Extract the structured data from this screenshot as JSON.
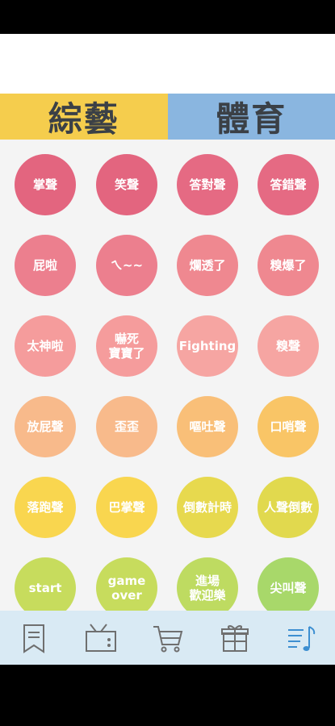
{
  "tabs": {
    "variety_label": "綜藝",
    "sports_label": "體育"
  },
  "sounds": [
    {
      "label": "掌聲",
      "color": "#e3657f"
    },
    {
      "label": "笑聲",
      "color": "#e3657f"
    },
    {
      "label": "答對聲",
      "color": "#e56a83"
    },
    {
      "label": "答錯聲",
      "color": "#e56a83"
    },
    {
      "label": "屁啦",
      "color": "#ec7f8e"
    },
    {
      "label": "ㄟ~~",
      "color": "#ec7f8e"
    },
    {
      "label": "爛透了",
      "color": "#ef8890"
    },
    {
      "label": "糗爆了",
      "color": "#ef8890"
    },
    {
      "label": "太神啦",
      "color": "#f59c9c"
    },
    {
      "label": "嚇死\n寶寶了",
      "color": "#f59c9c"
    },
    {
      "label": "Fighting",
      "color": "#f6a5a2"
    },
    {
      "label": "糗聲",
      "color": "#f6a5a2"
    },
    {
      "label": "放屁聲",
      "color": "#f8ba8b"
    },
    {
      "label": "歪歪",
      "color": "#f8ba8b"
    },
    {
      "label": "嘔吐聲",
      "color": "#f9bf78"
    },
    {
      "label": "口哨聲",
      "color": "#f9c566"
    },
    {
      "label": "落跑聲",
      "color": "#f9d64f"
    },
    {
      "label": "巴掌聲",
      "color": "#f9d64f"
    },
    {
      "label": "倒數計時",
      "color": "#e7d94e"
    },
    {
      "label": "人聲倒數",
      "color": "#e1d94e"
    },
    {
      "label": "start",
      "color": "#c7dc5d"
    },
    {
      "label": "game\nover",
      "color": "#c7dc5d"
    },
    {
      "label": "進場\n歡迎樂",
      "color": "#bedb61"
    },
    {
      "label": "尖叫聲",
      "color": "#a8d86a"
    }
  ],
  "nav": [
    {
      "icon": "bookmark-icon",
      "active": false
    },
    {
      "icon": "tv-icon",
      "active": false
    },
    {
      "icon": "cart-icon",
      "active": false
    },
    {
      "icon": "gift-icon",
      "active": false
    },
    {
      "icon": "music-list-icon",
      "active": true
    }
  ],
  "colors": {
    "nav_inactive": "#6f6f6f",
    "nav_active": "#3d8fd1"
  }
}
